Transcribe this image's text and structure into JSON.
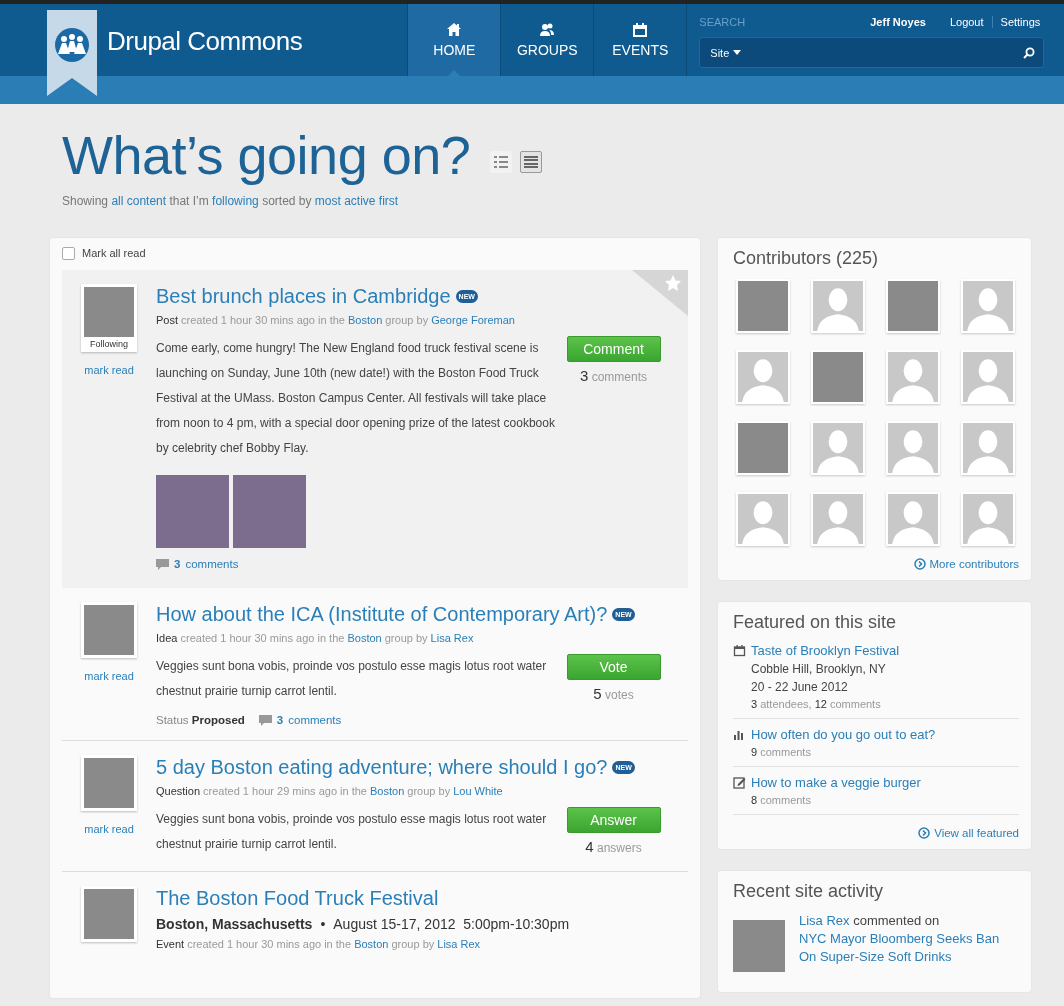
{
  "header": {
    "logo_text": "Drupal Commons",
    "nav": [
      {
        "label": "HOME",
        "kind": "home",
        "selected": true
      },
      {
        "label": "GROUPS",
        "kind": "people",
        "selected": false
      },
      {
        "label": "EVENTS",
        "kind": "calendar",
        "selected": false
      }
    ],
    "search": {
      "label": "SEARCH",
      "scope": "Site"
    },
    "user_links": [
      {
        "label": "Jeff Noyes",
        "kind": "user"
      },
      {
        "label": "Logout",
        "kind": "link"
      },
      {
        "label": "Settings",
        "kind": "link"
      }
    ]
  },
  "page": {
    "title": "What’s going on?",
    "views": [
      {
        "kind": "compact",
        "selected": false
      },
      {
        "kind": "full",
        "selected": true
      }
    ],
    "subtitle": [
      {
        "t": "Showing ",
        "kind": "plain"
      },
      {
        "t": "all content",
        "kind": "link"
      },
      {
        "t": " that I’m ",
        "kind": "plain"
      },
      {
        "t": "following",
        "kind": "link"
      },
      {
        "t": " sorted by ",
        "kind": "plain"
      },
      {
        "t": "most active first",
        "kind": "link"
      }
    ]
  },
  "feed": {
    "mark_all_read": {
      "label": "Mark all read",
      "checked": false
    },
    "items": [
      {
        "kind": "post",
        "highlighted": true,
        "bookmarked": true,
        "avatar_caption": "Following",
        "mark_read": "mark read",
        "title": "Best brunch places in Cambridge",
        "badge": "NEW",
        "meta": [
          {
            "t": "Post",
            "kind": "strong"
          },
          {
            "t": " created 1 hour 30 mins ago in the ",
            "kind": "muted"
          },
          {
            "t": "Boston",
            "kind": "link"
          },
          {
            "t": " group by ",
            "kind": "muted"
          },
          {
            "t": "George Foreman",
            "kind": "link"
          }
        ],
        "body": "Come early, come hungry! The New England food truck festival scene is launching on Sunday, June 10th (new date!) with the Boston Food Truck Festival at the UMass.  Boston Campus Center.  All festivals will take place from noon to 4 pm, with a special door opening prize of the latest cookbook by celebrity chef Bobby Flay.",
        "photos": [
          {
            "kind": "photo"
          },
          {
            "kind": "photo"
          }
        ],
        "action": {
          "label": "Comment",
          "count": "3",
          "unit": "comments"
        },
        "comments": {
          "count": "3",
          "label": "comments"
        }
      },
      {
        "kind": "idea",
        "highlighted": false,
        "bookmarked": false,
        "mark_read": "mark read",
        "title": "How about the ICA (Institute of Contemporary Art)?",
        "badge": "NEW",
        "meta": [
          {
            "t": "Idea",
            "kind": "strong"
          },
          {
            "t": " created 1 hour 30 mins ago in the ",
            "kind": "muted"
          },
          {
            "t": "Boston",
            "kind": "link"
          },
          {
            "t": " group by ",
            "kind": "muted"
          },
          {
            "t": "Lisa Rex",
            "kind": "link"
          }
        ],
        "body": "Veggies sunt bona vobis, proinde vos postulo esse magis lotus root water chestnut prairie turnip carrot lentil.",
        "action": {
          "label": "Vote",
          "count": "5",
          "unit": "votes"
        },
        "status": {
          "label": "Status",
          "value": "Proposed"
        },
        "comments": {
          "count": "3",
          "label": "comments"
        }
      },
      {
        "kind": "question",
        "highlighted": false,
        "bookmarked": false,
        "mark_read": "mark read",
        "title": "5 day Boston eating adventure; where should I go?",
        "badge": "NEW",
        "meta": [
          {
            "t": "Question",
            "kind": "strong"
          },
          {
            "t": " created 1 hour 29 mins ago in the ",
            "kind": "muted"
          },
          {
            "t": "Boston",
            "kind": "link"
          },
          {
            "t": " group by ",
            "kind": "muted"
          },
          {
            "t": "Lou White",
            "kind": "link"
          }
        ],
        "body": "Veggies sunt bona vobis, proinde vos postulo esse magis lotus root water chestnut prairie turnip carrot lentil.",
        "action": {
          "label": "Answer",
          "count": "4",
          "unit": "answers"
        }
      },
      {
        "kind": "event",
        "highlighted": false,
        "bookmarked": false,
        "title": "The Boston Food Truck Festival",
        "event_place": "Boston, Massachusetts",
        "event_separator": "•",
        "event_time": "August 15-17, 2012  5:00pm-10:30pm",
        "meta": [
          {
            "t": "Event",
            "kind": "strong"
          },
          {
            "t": " created 1 hour 30 mins ago in the ",
            "kind": "muted"
          },
          {
            "t": "Boston",
            "kind": "link"
          },
          {
            "t": " group by ",
            "kind": "muted"
          },
          {
            "t": "Lisa Rex",
            "kind": "link"
          }
        ]
      }
    ]
  },
  "sidebar": {
    "contributors": {
      "title": "Contributors (225)",
      "more": "More contributors",
      "avatars": [
        {
          "kind": "photo"
        },
        {
          "kind": "silhouette"
        },
        {
          "kind": "photo"
        },
        {
          "kind": "silhouette"
        },
        {
          "kind": "silhouette"
        },
        {
          "kind": "photo"
        },
        {
          "kind": "silhouette"
        },
        {
          "kind": "silhouette"
        },
        {
          "kind": "photo"
        },
        {
          "kind": "silhouette"
        },
        {
          "kind": "silhouette"
        },
        {
          "kind": "silhouette"
        },
        {
          "kind": "silhouette"
        },
        {
          "kind": "silhouette"
        },
        {
          "kind": "silhouette"
        },
        {
          "kind": "silhouette"
        }
      ]
    },
    "featured": {
      "title": "Featured on this site",
      "view_all": "View all featured",
      "items": [
        {
          "kind": "event",
          "title": "Taste of Brooklyn Festival",
          "lines": [
            "Cobble Hill, Brooklyn, NY",
            "20 - 22 June 2012"
          ],
          "stats": [
            {
              "t": "3",
              "kind": "num"
            },
            {
              "t": " attendees, ",
              "kind": "muted"
            },
            {
              "t": "12",
              "kind": "num"
            },
            {
              "t": " comments",
              "kind": "muted"
            }
          ]
        },
        {
          "kind": "poll",
          "title": "How often do you go out to eat?",
          "stats": [
            {
              "t": "9",
              "kind": "num"
            },
            {
              "t": " comments",
              "kind": "muted"
            }
          ]
        },
        {
          "kind": "article",
          "title": "How to make a veggie burger",
          "stats": [
            {
              "t": "8",
              "kind": "num"
            },
            {
              "t": " comments",
              "kind": "muted"
            }
          ]
        }
      ]
    },
    "activity": {
      "title": "Recent site activity",
      "entries": [
        {
          "text": [
            {
              "t": "Lisa Rex",
              "kind": "link"
            },
            {
              "t": " commented on",
              "kind": "plain"
            },
            {
              "t": "NYC Mayor Bloomberg Seeks Ban On Super-Size Soft Drinks",
              "kind": "block_link"
            }
          ]
        }
      ]
    }
  }
}
